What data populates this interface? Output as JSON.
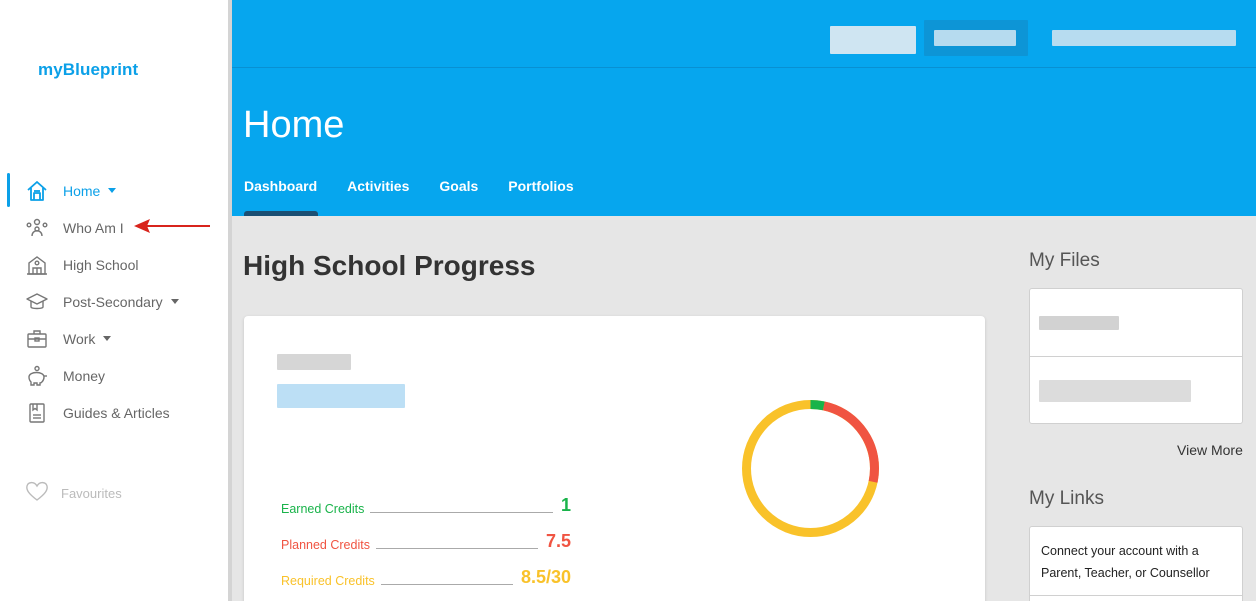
{
  "app": {
    "brand": "myBlueprint"
  },
  "colors": {
    "primary": "#06a6ee",
    "earned": "#19b34a",
    "planned": "#f05442",
    "required": "#f9c22a"
  },
  "sidebar": {
    "items": [
      {
        "label": "Home",
        "icon": "home-icon",
        "active": true,
        "has_caret": true
      },
      {
        "label": "Who Am I",
        "icon": "people-icon",
        "active": false,
        "has_caret": false
      },
      {
        "label": "High School",
        "icon": "school-building-icon",
        "active": false,
        "has_caret": false
      },
      {
        "label": "Post-Secondary",
        "icon": "graduation-cap-icon",
        "active": false,
        "has_caret": true
      },
      {
        "label": "Work",
        "icon": "briefcase-icon",
        "active": false,
        "has_caret": true
      },
      {
        "label": "Money",
        "icon": "piggy-bank-icon",
        "active": false,
        "has_caret": false
      },
      {
        "label": "Guides & Articles",
        "icon": "book-icon",
        "active": false,
        "has_caret": false
      }
    ],
    "favourites": {
      "label": "Favourites",
      "icon": "heart-icon"
    }
  },
  "header": {
    "page_title": "Home",
    "tabs": [
      {
        "label": "Dashboard",
        "active": true
      },
      {
        "label": "Activities",
        "active": false
      },
      {
        "label": "Goals",
        "active": false
      },
      {
        "label": "Portfolios",
        "active": false
      }
    ]
  },
  "main": {
    "section_title": "High School Progress",
    "credits": {
      "earned": {
        "label": "Earned Credits",
        "value": "1"
      },
      "planned": {
        "label": "Planned Credits",
        "value": "7.5"
      },
      "required": {
        "label": "Required Credits",
        "value": "8.5/30"
      }
    },
    "progress_ring": {
      "earned": 1,
      "planned": 7.5,
      "total": 30
    }
  },
  "right": {
    "my_files_title": "My Files",
    "view_more": "View More",
    "my_links_title": "My Links",
    "links_text": "Connect your account with a Parent, Teacher, or Counsellor"
  }
}
